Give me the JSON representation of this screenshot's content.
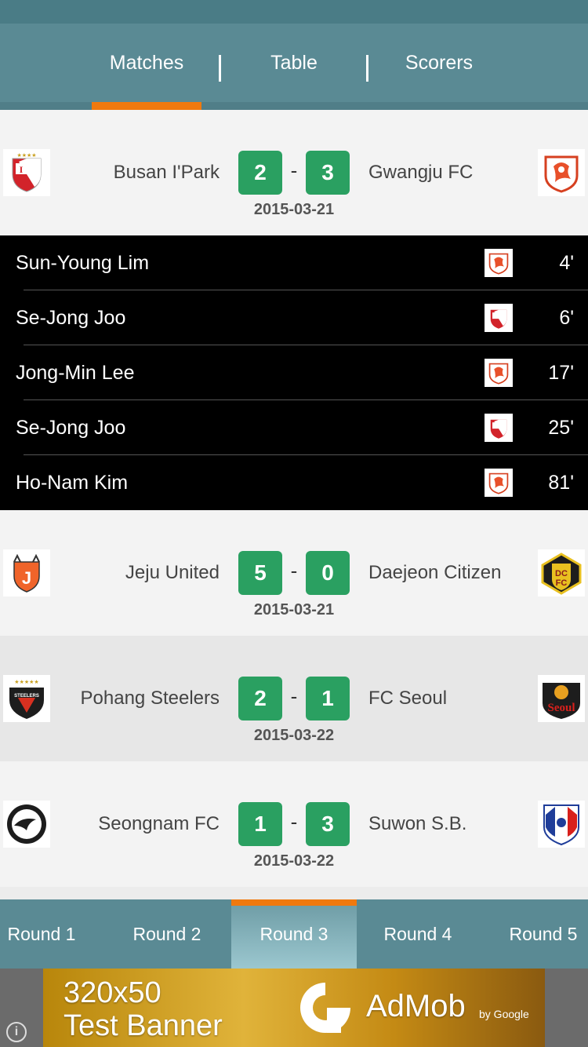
{
  "tabs": [
    {
      "label": "Matches",
      "active": true
    },
    {
      "label": "Table",
      "active": false
    },
    {
      "label": "Scorers",
      "active": false
    }
  ],
  "matches": [
    {
      "home": "Busan I'Park",
      "away": "Gwangju FC",
      "home_score": "2",
      "away_score": "3",
      "dash": "-",
      "date": "2015-03-21",
      "home_logo": "busan-crest-icon",
      "away_logo": "gwangju-crest-icon"
    },
    {
      "home": "Jeju United",
      "away": "Daejeon Citizen",
      "home_score": "5",
      "away_score": "0",
      "dash": "-",
      "date": "2015-03-21",
      "home_logo": "jeju-crest-icon",
      "away_logo": "daejeon-crest-icon"
    },
    {
      "home": "Pohang Steelers",
      "away": "FC Seoul",
      "home_score": "2",
      "away_score": "1",
      "dash": "-",
      "date": "2015-03-22",
      "home_logo": "pohang-crest-icon",
      "away_logo": "seoul-crest-icon"
    },
    {
      "home": "Seongnam FC",
      "away": "Suwon S.B.",
      "home_score": "1",
      "away_score": "3",
      "dash": "-",
      "date": "2015-03-22",
      "home_logo": "seongnam-crest-icon",
      "away_logo": "suwon-crest-icon"
    }
  ],
  "goals": [
    {
      "player": "Sun-Young Lim",
      "minute": "4'",
      "team": "gwangju"
    },
    {
      "player": "Se-Jong Joo",
      "minute": "6'",
      "team": "busan"
    },
    {
      "player": "Jong-Min Lee",
      "minute": "17'",
      "team": "gwangju"
    },
    {
      "player": "Se-Jong Joo",
      "minute": "25'",
      "team": "busan"
    },
    {
      "player": "Ho-Nam Kim",
      "minute": "81'",
      "team": "gwangju"
    }
  ],
  "rounds": [
    {
      "label": "Round 1",
      "active": false
    },
    {
      "label": "Round 2",
      "active": false
    },
    {
      "label": "Round 3",
      "active": true
    },
    {
      "label": "Round 4",
      "active": false
    },
    {
      "label": "Round 5",
      "active": false
    }
  ],
  "ad": {
    "line1": "320x50",
    "line2": "Test Banner",
    "brand": "AdMob",
    "by": "by Google",
    "info": "i"
  },
  "colors": {
    "header": "#5a8a94",
    "accent": "#f0790e",
    "score": "#2aa061"
  }
}
